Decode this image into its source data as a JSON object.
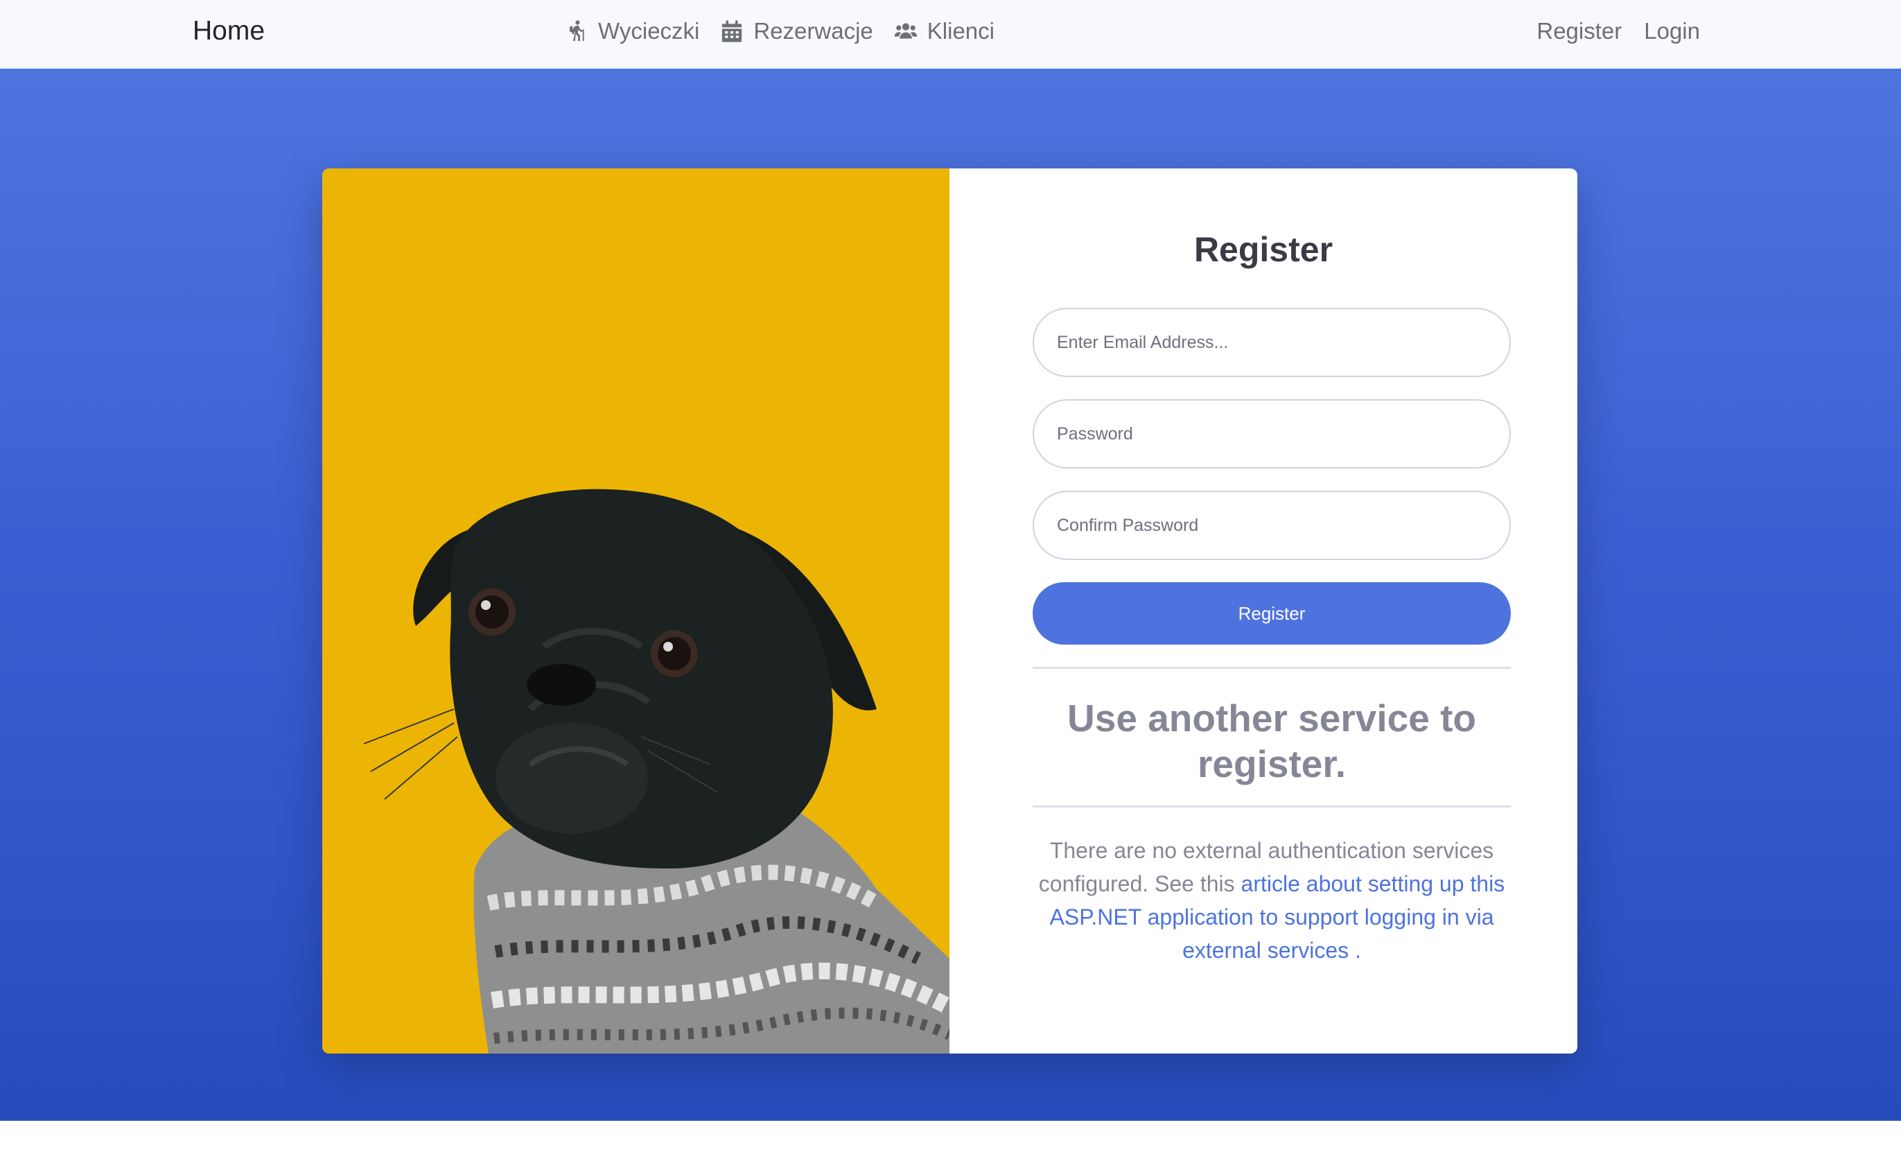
{
  "navbar": {
    "brand": "Home",
    "center_items": [
      {
        "label": "Wycieczki",
        "icon": "hiking-icon"
      },
      {
        "label": "Rezerwacje",
        "icon": "calendar-icon"
      },
      {
        "label": "Klienci",
        "icon": "users-icon"
      }
    ],
    "right_links": [
      "Register",
      "Login"
    ]
  },
  "form": {
    "title": "Register",
    "email_placeholder": "Enter Email Address...",
    "password_placeholder": "Password",
    "confirm_placeholder": "Confirm Password",
    "submit_label": "Register"
  },
  "external": {
    "title": "Use another service to register.",
    "text_before": "There are no external authentication services configured. See this",
    "link_text": "article about setting up this ASP.NET application to support logging in via external services",
    "text_after": "."
  },
  "colors": {
    "primary": "#4e73df",
    "photo_background": "#ecb505",
    "hero_gradient_top": "#4e75de",
    "hero_gradient_bottom": "#264cbc"
  }
}
